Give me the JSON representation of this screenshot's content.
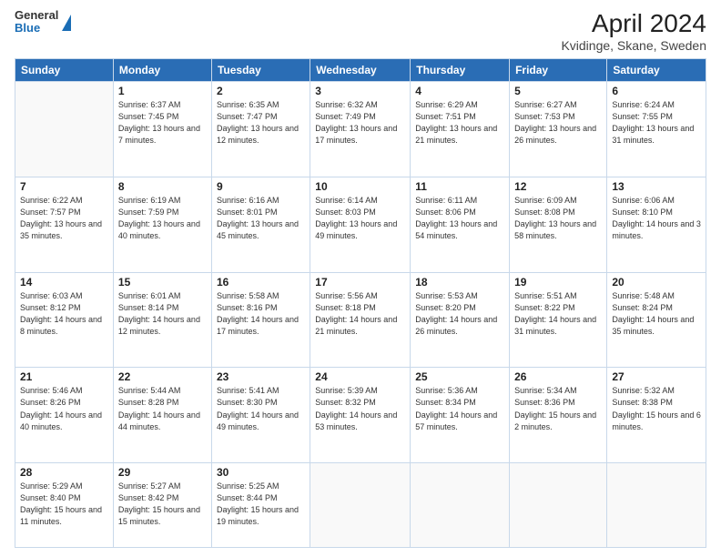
{
  "header": {
    "logo_general": "General",
    "logo_blue": "Blue",
    "title": "April 2024",
    "subtitle": "Kvidinge, Skane, Sweden"
  },
  "days_of_week": [
    "Sunday",
    "Monday",
    "Tuesday",
    "Wednesday",
    "Thursday",
    "Friday",
    "Saturday"
  ],
  "weeks": [
    [
      {
        "day": "",
        "sunrise": "",
        "sunset": "",
        "daylight": ""
      },
      {
        "day": "1",
        "sunrise": "Sunrise: 6:37 AM",
        "sunset": "Sunset: 7:45 PM",
        "daylight": "Daylight: 13 hours and 7 minutes."
      },
      {
        "day": "2",
        "sunrise": "Sunrise: 6:35 AM",
        "sunset": "Sunset: 7:47 PM",
        "daylight": "Daylight: 13 hours and 12 minutes."
      },
      {
        "day": "3",
        "sunrise": "Sunrise: 6:32 AM",
        "sunset": "Sunset: 7:49 PM",
        "daylight": "Daylight: 13 hours and 17 minutes."
      },
      {
        "day": "4",
        "sunrise": "Sunrise: 6:29 AM",
        "sunset": "Sunset: 7:51 PM",
        "daylight": "Daylight: 13 hours and 21 minutes."
      },
      {
        "day": "5",
        "sunrise": "Sunrise: 6:27 AM",
        "sunset": "Sunset: 7:53 PM",
        "daylight": "Daylight: 13 hours and 26 minutes."
      },
      {
        "day": "6",
        "sunrise": "Sunrise: 6:24 AM",
        "sunset": "Sunset: 7:55 PM",
        "daylight": "Daylight: 13 hours and 31 minutes."
      }
    ],
    [
      {
        "day": "7",
        "sunrise": "Sunrise: 6:22 AM",
        "sunset": "Sunset: 7:57 PM",
        "daylight": "Daylight: 13 hours and 35 minutes."
      },
      {
        "day": "8",
        "sunrise": "Sunrise: 6:19 AM",
        "sunset": "Sunset: 7:59 PM",
        "daylight": "Daylight: 13 hours and 40 minutes."
      },
      {
        "day": "9",
        "sunrise": "Sunrise: 6:16 AM",
        "sunset": "Sunset: 8:01 PM",
        "daylight": "Daylight: 13 hours and 45 minutes."
      },
      {
        "day": "10",
        "sunrise": "Sunrise: 6:14 AM",
        "sunset": "Sunset: 8:03 PM",
        "daylight": "Daylight: 13 hours and 49 minutes."
      },
      {
        "day": "11",
        "sunrise": "Sunrise: 6:11 AM",
        "sunset": "Sunset: 8:06 PM",
        "daylight": "Daylight: 13 hours and 54 minutes."
      },
      {
        "day": "12",
        "sunrise": "Sunrise: 6:09 AM",
        "sunset": "Sunset: 8:08 PM",
        "daylight": "Daylight: 13 hours and 58 minutes."
      },
      {
        "day": "13",
        "sunrise": "Sunrise: 6:06 AM",
        "sunset": "Sunset: 8:10 PM",
        "daylight": "Daylight: 14 hours and 3 minutes."
      }
    ],
    [
      {
        "day": "14",
        "sunrise": "Sunrise: 6:03 AM",
        "sunset": "Sunset: 8:12 PM",
        "daylight": "Daylight: 14 hours and 8 minutes."
      },
      {
        "day": "15",
        "sunrise": "Sunrise: 6:01 AM",
        "sunset": "Sunset: 8:14 PM",
        "daylight": "Daylight: 14 hours and 12 minutes."
      },
      {
        "day": "16",
        "sunrise": "Sunrise: 5:58 AM",
        "sunset": "Sunset: 8:16 PM",
        "daylight": "Daylight: 14 hours and 17 minutes."
      },
      {
        "day": "17",
        "sunrise": "Sunrise: 5:56 AM",
        "sunset": "Sunset: 8:18 PM",
        "daylight": "Daylight: 14 hours and 21 minutes."
      },
      {
        "day": "18",
        "sunrise": "Sunrise: 5:53 AM",
        "sunset": "Sunset: 8:20 PM",
        "daylight": "Daylight: 14 hours and 26 minutes."
      },
      {
        "day": "19",
        "sunrise": "Sunrise: 5:51 AM",
        "sunset": "Sunset: 8:22 PM",
        "daylight": "Daylight: 14 hours and 31 minutes."
      },
      {
        "day": "20",
        "sunrise": "Sunrise: 5:48 AM",
        "sunset": "Sunset: 8:24 PM",
        "daylight": "Daylight: 14 hours and 35 minutes."
      }
    ],
    [
      {
        "day": "21",
        "sunrise": "Sunrise: 5:46 AM",
        "sunset": "Sunset: 8:26 PM",
        "daylight": "Daylight: 14 hours and 40 minutes."
      },
      {
        "day": "22",
        "sunrise": "Sunrise: 5:44 AM",
        "sunset": "Sunset: 8:28 PM",
        "daylight": "Daylight: 14 hours and 44 minutes."
      },
      {
        "day": "23",
        "sunrise": "Sunrise: 5:41 AM",
        "sunset": "Sunset: 8:30 PM",
        "daylight": "Daylight: 14 hours and 49 minutes."
      },
      {
        "day": "24",
        "sunrise": "Sunrise: 5:39 AM",
        "sunset": "Sunset: 8:32 PM",
        "daylight": "Daylight: 14 hours and 53 minutes."
      },
      {
        "day": "25",
        "sunrise": "Sunrise: 5:36 AM",
        "sunset": "Sunset: 8:34 PM",
        "daylight": "Daylight: 14 hours and 57 minutes."
      },
      {
        "day": "26",
        "sunrise": "Sunrise: 5:34 AM",
        "sunset": "Sunset: 8:36 PM",
        "daylight": "Daylight: 15 hours and 2 minutes."
      },
      {
        "day": "27",
        "sunrise": "Sunrise: 5:32 AM",
        "sunset": "Sunset: 8:38 PM",
        "daylight": "Daylight: 15 hours and 6 minutes."
      }
    ],
    [
      {
        "day": "28",
        "sunrise": "Sunrise: 5:29 AM",
        "sunset": "Sunset: 8:40 PM",
        "daylight": "Daylight: 15 hours and 11 minutes."
      },
      {
        "day": "29",
        "sunrise": "Sunrise: 5:27 AM",
        "sunset": "Sunset: 8:42 PM",
        "daylight": "Daylight: 15 hours and 15 minutes."
      },
      {
        "day": "30",
        "sunrise": "Sunrise: 5:25 AM",
        "sunset": "Sunset: 8:44 PM",
        "daylight": "Daylight: 15 hours and 19 minutes."
      },
      {
        "day": "",
        "sunrise": "",
        "sunset": "",
        "daylight": ""
      },
      {
        "day": "",
        "sunrise": "",
        "sunset": "",
        "daylight": ""
      },
      {
        "day": "",
        "sunrise": "",
        "sunset": "",
        "daylight": ""
      },
      {
        "day": "",
        "sunrise": "",
        "sunset": "",
        "daylight": ""
      }
    ]
  ]
}
